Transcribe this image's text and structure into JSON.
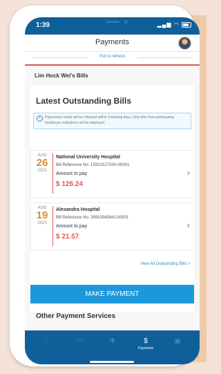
{
  "status": {
    "time": "1:39",
    "signal": "▂▄▆",
    "wifi": "◠"
  },
  "header": {
    "title": "Payments"
  },
  "refresh": {
    "text": "Pull to refresh"
  },
  "owner": "Lim Hock Wei's Bills",
  "latest": {
    "heading": "Latest Outstanding Bills",
    "info": "Payment(s) made will be reflected within 3 working days. Only bills from participating healthcare institutions will be displayed.",
    "bills": [
      {
        "month": "AUG",
        "day": "26",
        "year": "2021",
        "hospital": "National University Hospital",
        "reference": "Bill Reference No: 1591012702H-00001",
        "amount_label": "Amount to pay",
        "amount": "$ 126.24"
      },
      {
        "month": "AUG",
        "day": "19",
        "year": "2021",
        "hospital": "Alexandra Hospital",
        "reference": "Bill Reference No: 2891004584J-00001",
        "amount_label": "Amount to pay",
        "amount": "$ 21.57"
      }
    ],
    "view_all": "View All Outstanding Bills",
    "make_payment": "MAKE PAYMENT"
  },
  "other": {
    "heading": "Other Payment Services"
  },
  "tabs": [
    {
      "icon": "⌂",
      "label": ""
    },
    {
      "icon": "▭",
      "label": ""
    },
    {
      "icon": "✚",
      "label": ""
    },
    {
      "icon": "$",
      "label": "Payments"
    },
    {
      "icon": "▣",
      "label": ""
    }
  ],
  "colors": {
    "brand": "#0f5f9b",
    "accent": "#1c97db",
    "amount": "#e05a4d",
    "date": "#d88a3d"
  }
}
